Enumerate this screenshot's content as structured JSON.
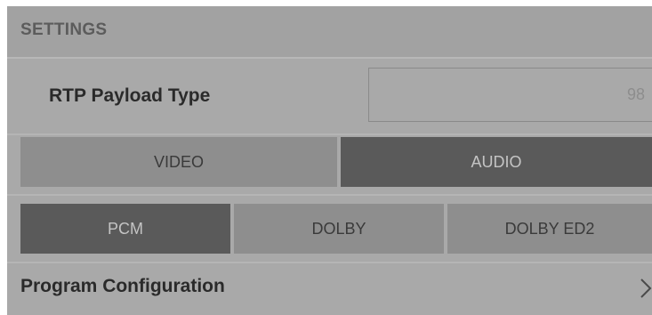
{
  "header": {
    "title": "SETTINGS"
  },
  "rtp": {
    "label": "RTP Payload Type",
    "value": "98"
  },
  "media_tabs": [
    {
      "label": "VIDEO",
      "selected": false
    },
    {
      "label": "AUDIO",
      "selected": true
    }
  ],
  "audio_formats": [
    {
      "label": "PCM",
      "selected": true
    },
    {
      "label": "DOLBY",
      "selected": false
    },
    {
      "label": "DOLBY ED2",
      "selected": false
    }
  ],
  "program": {
    "label": "Program Configuration",
    "icon": "chevron-right-icon"
  },
  "colors": {
    "panel_bg": "#a9a9a9",
    "segment_selected": "#5a5a5a",
    "segment_unselected": "#8e8e8e"
  }
}
